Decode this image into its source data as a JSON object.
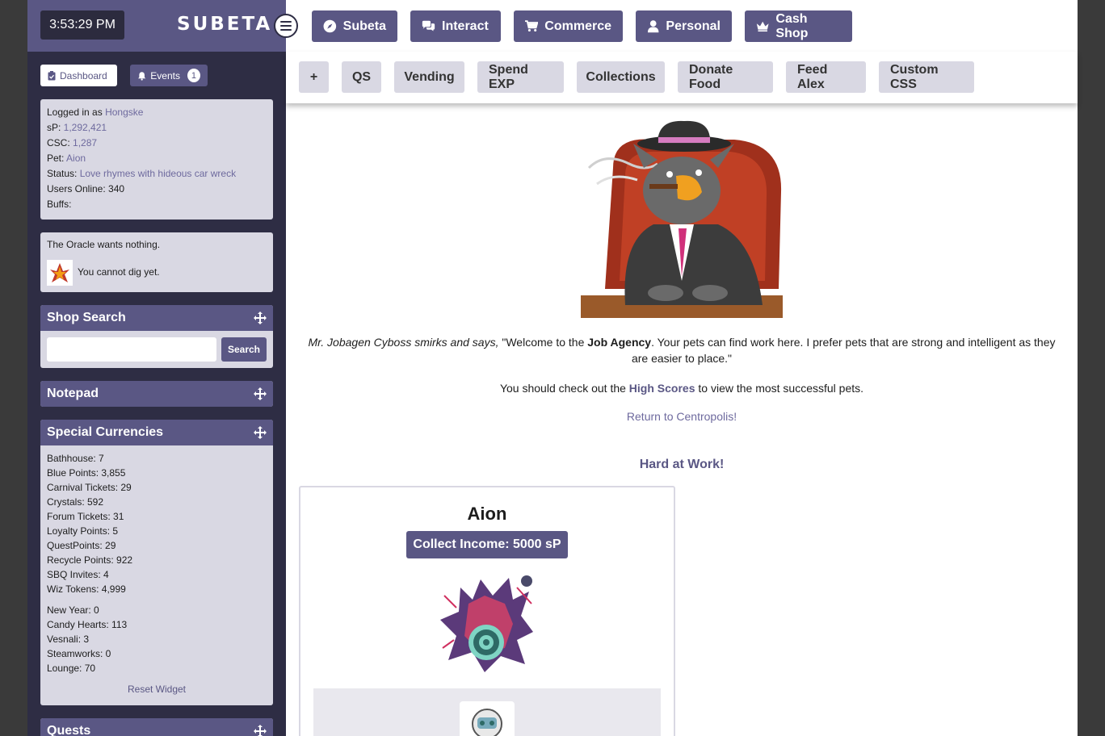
{
  "clock": "3:53:29 PM",
  "logo": "SUBETA",
  "sidebar": {
    "dashboard_label": "Dashboard",
    "events_label": "Events",
    "events_count": "1",
    "user": {
      "logged_in_prefix": "Logged in as ",
      "username": "Hongske",
      "sp_label": "sP: ",
      "sp": "1,292,421",
      "csc_label": "CSC: ",
      "csc": "1,287",
      "pet_label": "Pet: ",
      "pet": "Aion",
      "status_label": "Status: ",
      "status": "Love rhymes with hideous car wreck",
      "online": "Users Online: 340",
      "buffs": "Buffs:"
    },
    "oracle": {
      "text": "The Oracle wants nothing.",
      "dig": "You cannot dig yet."
    },
    "shop_search": {
      "title": "Shop Search",
      "placeholder": "",
      "button": "Search"
    },
    "notepad_title": "Notepad",
    "special_currencies": {
      "title": "Special Currencies",
      "group1": [
        "Bathhouse: 7",
        "Blue Points: 3,855",
        "Carnival Tickets: 29",
        "Crystals: 592",
        "Forum Tickets: 31",
        "Loyalty Points: 5",
        "QuestPoints: 29",
        "Recycle Points: 922",
        "SBQ Invites: 4",
        "Wiz Tokens: 4,999"
      ],
      "group2": [
        "New Year: 0",
        "Candy Hearts: 113",
        "Vesnali: 3",
        "Steamworks: 0",
        "Lounge: 70"
      ],
      "reset": "Reset Widget"
    },
    "quests_title": "Quests"
  },
  "topnav": {
    "items": [
      "Subeta",
      "Interact",
      "Commerce",
      "Personal",
      "Cash Shop"
    ],
    "icons": [
      "compass-icon",
      "chat-icon",
      "cart-icon",
      "user-icon",
      "crown-icon"
    ]
  },
  "subnav": {
    "items": [
      "+",
      "QS",
      "Vending",
      "Spend EXP",
      "Collections",
      "Donate Food",
      "Feed Alex",
      "Custom CSS"
    ]
  },
  "main": {
    "npc_name": "Mr. Jobagen Cyboss smirks and says,",
    "speech_pre": " \"Welcome to the ",
    "speech_bold": "Job Agency",
    "speech_post": ". Your pets can find work here. I prefer pets that are strong and intelligent as they are easier to place.\"",
    "highscore_pre": "You should check out the ",
    "highscore_link": "High Scores",
    "highscore_post": " to view the most successful pets.",
    "return_link": "Return to Centropolis!",
    "hard_at_work": "Hard at Work!",
    "pet_name": "Aion",
    "collect_button": "Collect Income: 5000 sP"
  },
  "colors": {
    "brand": "#5a5784",
    "sidebar_bg": "#2e2d44",
    "card_bg": "#d9d8e3",
    "link": "#6e6a9e"
  }
}
